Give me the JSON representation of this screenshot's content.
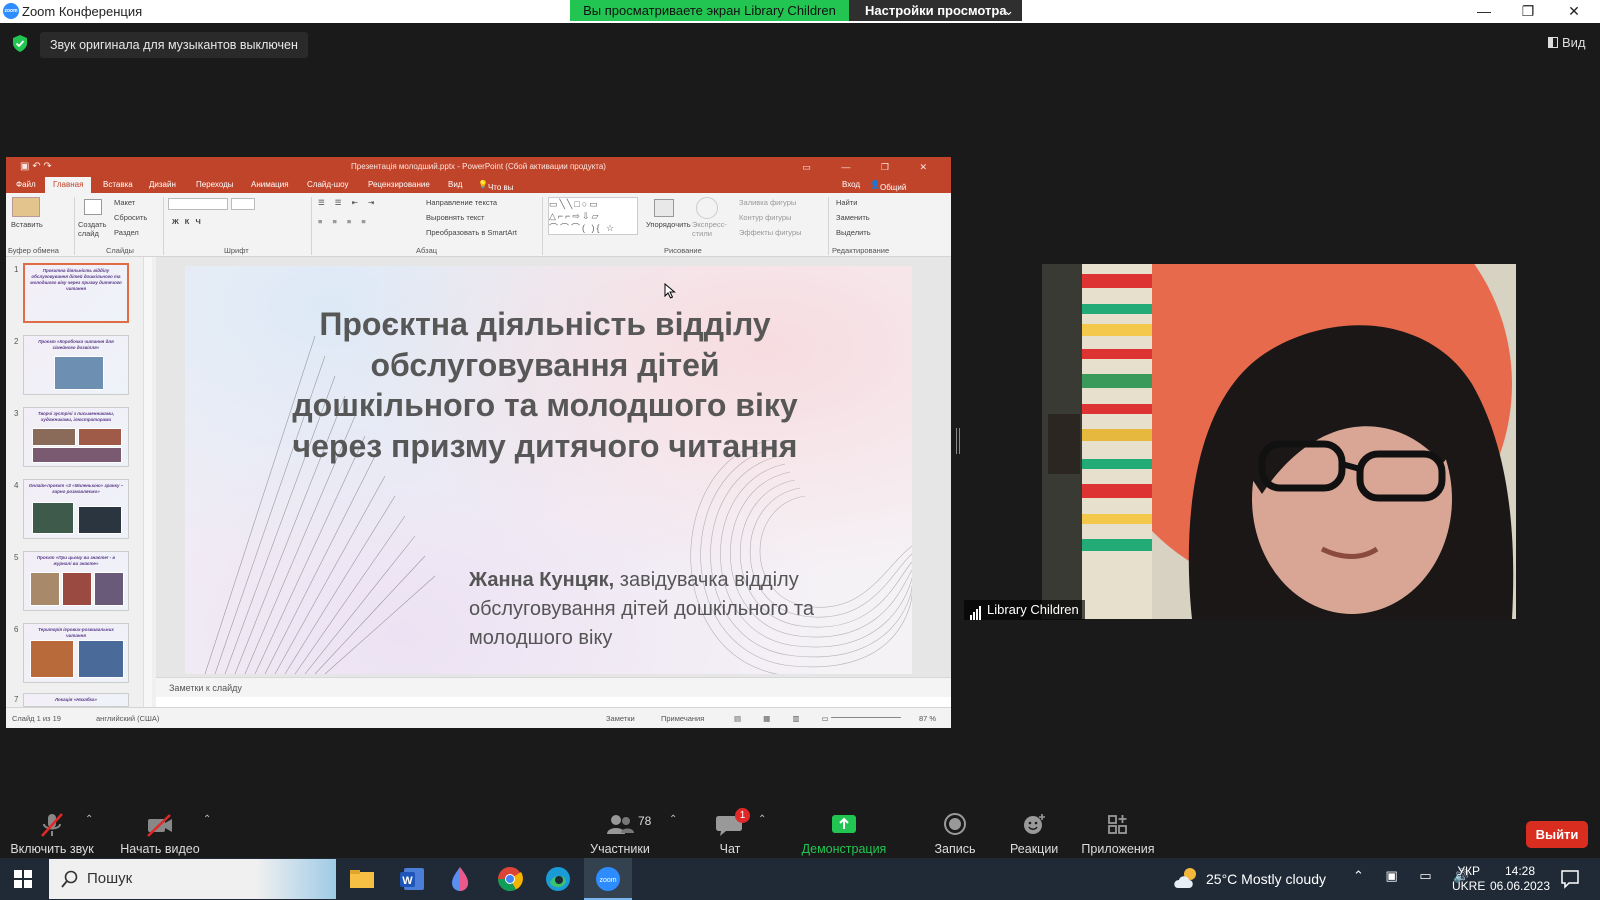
{
  "window": {
    "title": "Zoom Конференция",
    "minimize": "—",
    "restore": "❐",
    "close": "✕"
  },
  "share_banner": {
    "viewing": "Вы просматриваете экран Library Children",
    "settings": "Настройки просмотра",
    "chevron": "⌄"
  },
  "notice": {
    "text": "Звук оригинала для музыкантов выключен"
  },
  "view_button": {
    "label": "Вид"
  },
  "ppt": {
    "title": "Презентація молодший.pptx - PowerPoint (Сбой активации продукта)",
    "tabs": [
      "Файл",
      "Главная",
      "Вставка",
      "Дизайн",
      "Переходы",
      "Анимация",
      "Слайд-шоу",
      "Рецензирование",
      "Вид",
      "Что вы хотите сделать?"
    ],
    "signin": "Вход",
    "share": "Общий доступ",
    "ribbon": {
      "paste": "Вставить",
      "clipboard": "Буфер обмена",
      "new_slide": "Создать слайд",
      "layout": "Макет",
      "reset": "Сбросить",
      "section": "Раздел",
      "slides": "Слайды",
      "font": "Шрифт",
      "paragraph": "Абзац",
      "text_dir": "Направление текста",
      "align_text": "Выровнять текст",
      "smartart": "Преобразовать в SmartArt",
      "arrange": "Упорядочить",
      "quick_styles": "Экспресс-стили",
      "fill": "Заливка фигуры",
      "outline": "Контур фигуры",
      "effects": "Эффекты фигуры",
      "drawing": "Рисование",
      "find": "Найти",
      "replace": "Заменить",
      "select": "Выделить",
      "editing": "Редактирование"
    },
    "thumbnails": [
      {
        "num": "1",
        "title": "Проєктна діяльність відділу обслуговування дітей дошкільного та молодшого віку через призму дитячого читання"
      },
      {
        "num": "2",
        "title": "Проєкт «Коробочка читання для сімейного дозвілля»"
      },
      {
        "num": "3",
        "title": "Творчі зустрічі з письменниками, художниками, ілюстраторами"
      },
      {
        "num": "4",
        "title": "Онлайн-проєкт «З «Маленькою» зранку – гарно розмовляємо»"
      },
      {
        "num": "5",
        "title": "Проєкт «При цьому ви знаєте! - в журналі ви знаєте»"
      },
      {
        "num": "6",
        "title": "Територія ігрових-розвивальних читання"
      },
      {
        "num": "7",
        "title": "Локація «Нахабка»"
      }
    ],
    "slide": {
      "title": "Проєктна діяльність відділу обслуговування дітей дошкільного та молодшого віку через призму дитячого читання",
      "author": "Жанна Кунцяк,",
      "role": " завідувачка відділу обслуговування дітей дошкільного та молодшого віку"
    },
    "notes": "Заметки к слайду",
    "status": {
      "slide": "Слайд 1 из 19",
      "lang": "английский (США)",
      "notes": "Заметки",
      "comments": "Примечания",
      "zoom": "87 %"
    }
  },
  "participant": {
    "name": "Library Children"
  },
  "toolbar": {
    "unmute": "Включить звук",
    "video": "Начать видео",
    "participants": "Участники",
    "participants_count": "78",
    "chat": "Чат",
    "chat_badge": "1",
    "share": "Демонстрация экрана",
    "record": "Запись",
    "reactions": "Реакции",
    "apps": "Приложения",
    "leave": "Выйти"
  },
  "taskbar": {
    "search": "Пошук",
    "weather": "25°C  Mostly cloudy",
    "lang1": "УКР",
    "lang2": "UKRE",
    "time": "14:28",
    "date": "06.06.2023"
  },
  "colors": {
    "ppt_accent": "#c0442a",
    "zoom_green": "#23c552",
    "leave_red": "#d92d20",
    "zoom_blue": "#2d8cff"
  }
}
